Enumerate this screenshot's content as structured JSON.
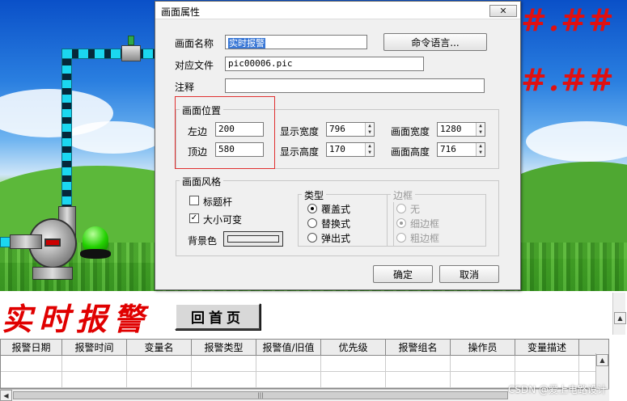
{
  "scene": {
    "placeholder_values": [
      "#.##",
      "#.##"
    ],
    "colors": {
      "alarm_red": "#e00000",
      "pipe_cyan": "#1bd7f0",
      "lamp_green": "#22d000"
    }
  },
  "dialog": {
    "title": "画面属性",
    "close_icon": "close-icon",
    "fields": {
      "name_label": "画面名称",
      "name_value": "实时报警",
      "file_label": "对应文件",
      "file_value": "pic00006.pic",
      "note_label": "注释",
      "note_value": ""
    },
    "command_button": "命令语言...",
    "position": {
      "group_title": "画面位置",
      "left_label": "左边",
      "left_value": "200",
      "top_label": "顶边",
      "top_value": "580",
      "display_width_label": "显示宽度",
      "display_width_value": "796",
      "display_height_label": "显示高度",
      "display_height_value": "170",
      "screen_width_label": "画面宽度",
      "screen_width_value": "1280",
      "screen_height_label": "画面高度",
      "screen_height_value": "716"
    },
    "style": {
      "group_title": "画面风格",
      "titlebar_label": "标题杆",
      "titlebar_checked": false,
      "resizable_label": "大小可变",
      "resizable_checked": true,
      "bgcolor_label": "背景色",
      "type_title": "类型",
      "type_options": [
        "覆盖式",
        "替换式",
        "弹出式"
      ],
      "type_selected": "覆盖式",
      "border_title": "边框",
      "border_options": [
        "无",
        "细边框",
        "粗边框"
      ],
      "border_selected": "细边框"
    },
    "ok_button": "确定",
    "cancel_button": "取消"
  },
  "alarm": {
    "title": "实时报警",
    "home_button": "回首页",
    "columns": [
      "报警日期",
      "报警时间",
      "变量名",
      "报警类型",
      "报警值/旧值",
      "优先级",
      "报警组名",
      "操作员",
      "变量描述"
    ]
  },
  "watermark": "CSDN @爱上电路设计"
}
